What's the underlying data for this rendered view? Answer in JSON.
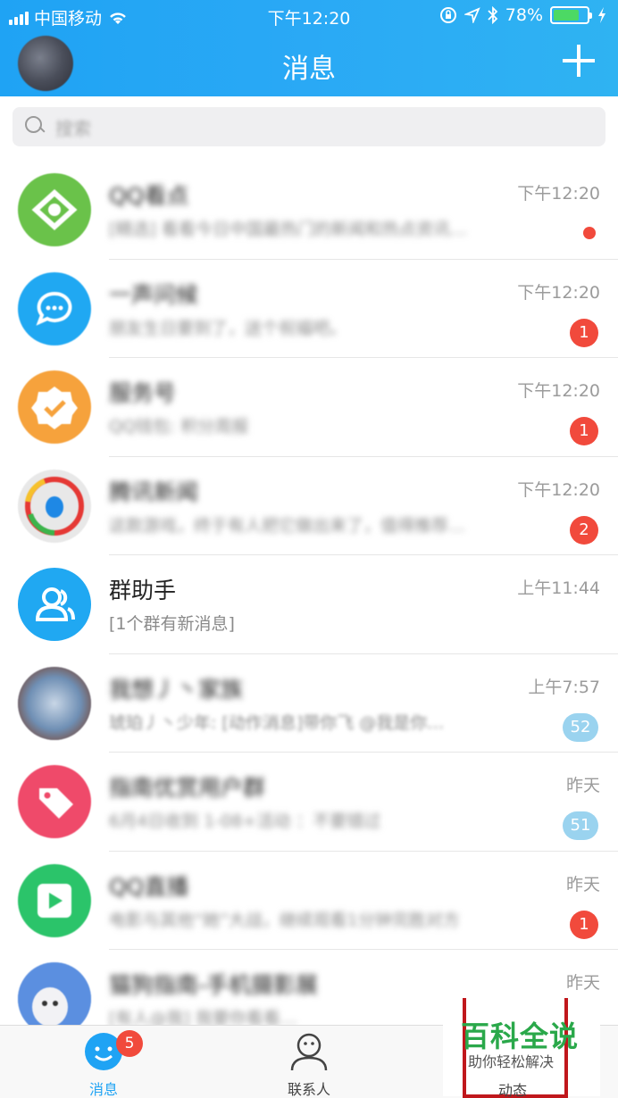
{
  "status_bar": {
    "carrier": "中国移动",
    "time": "下午12:20",
    "battery": "78%",
    "battery_level": 0.78
  },
  "header": {
    "title": "消息"
  },
  "search": {
    "placeholder": "搜索"
  },
  "conversations": [
    {
      "name": "QQ看点",
      "time": "下午12:20",
      "preview": "[精选] 看看今日中国最热门的新闻和热点资讯…",
      "unread": "",
      "dot": true,
      "avatar": "qq-kandian-icon",
      "color": "#6ac24a"
    },
    {
      "name": "一声问候",
      "time": "下午12:20",
      "preview": "朋友生日要到了，送个祝福吧。",
      "unread": "1",
      "dot": false,
      "avatar": "chat-bubble-icon",
      "color": "#20a8f2"
    },
    {
      "name": "服务号",
      "time": "下午12:20",
      "preview": "QQ钱包: 积分周报",
      "unread": "1",
      "dot": false,
      "avatar": "verified-badge-icon",
      "color": "#f6a23c"
    },
    {
      "name": "腾讯新闻",
      "time": "下午12:20",
      "preview": "这款游戏，终于有人把它做出来了，值得推荐…",
      "unread": "2",
      "dot": false,
      "avatar": "tencent-news-icon",
      "color": "#e8e8e8"
    },
    {
      "name": "群助手",
      "time": "上午11:44",
      "preview": "[1个群有新消息]",
      "unread": "",
      "dot": false,
      "avatar": "group-helper-icon",
      "color": "#20a8f2"
    },
    {
      "name": "我想丿丶家族",
      "time": "上午7:57",
      "preview": "琥珀丿丶少年: [动作消息]带你飞 @我是你…",
      "unread": "52",
      "dot": false,
      "avatar": "group-photo-icon",
      "color": "#7aa0c8"
    },
    {
      "name": "指南优赏用户群",
      "time": "昨天",
      "preview": "6月4日收到 1-08+活动 ：不要错过",
      "unread": "51",
      "dot": false,
      "avatar": "tag-icon",
      "color": "#ef4a6a"
    },
    {
      "name": "QQ直播",
      "time": "昨天",
      "preview": "电影与其他“她”大战，继续观看1分钟完胜对方",
      "unread": "1",
      "dot": false,
      "avatar": "live-play-icon",
      "color": "#2bc46a"
    },
    {
      "name": "猫狗指南-手机摄影展",
      "time": "昨天",
      "preview": "[有人@我] 我要你看看…",
      "unread": "",
      "dot": false,
      "avatar": "cartoon-avatar-icon",
      "color": "#5b8fe0"
    }
  ],
  "tabs": {
    "messages": "消息",
    "messages_badge": "5",
    "contacts": "联系人",
    "dynamics": "动态"
  },
  "watermark": {
    "title": "百科全说",
    "subtitle": "助你轻松解决"
  }
}
